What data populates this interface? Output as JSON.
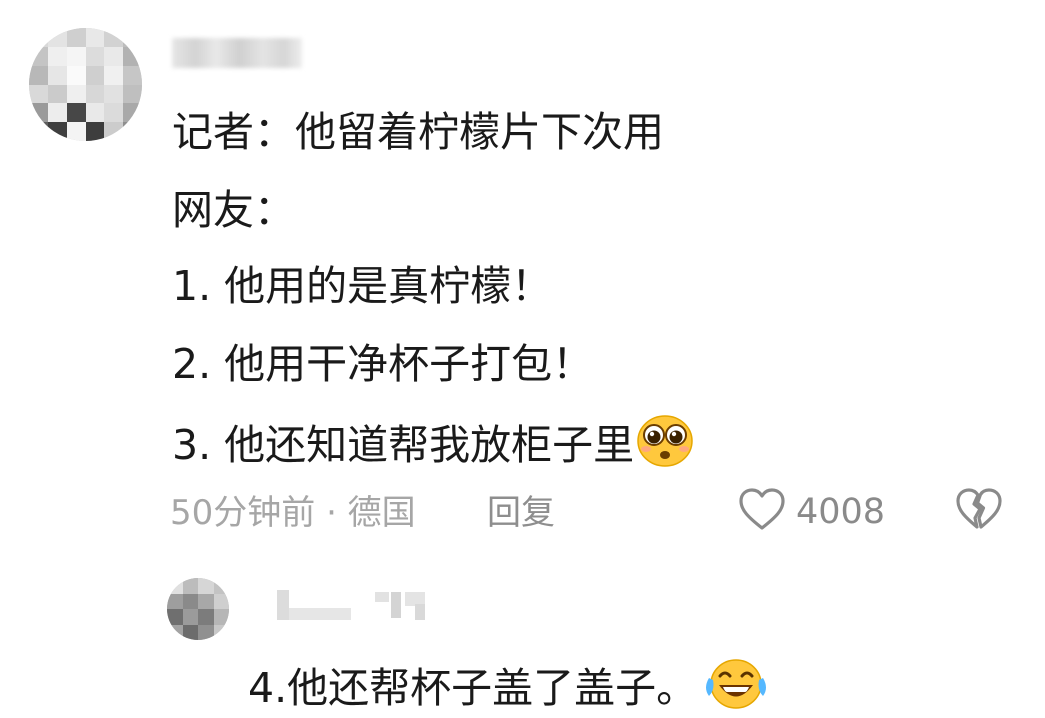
{
  "comment": {
    "lines": [
      "记者：他留着柠檬片下次用",
      "网友：",
      "1. 他用的是真柠檬！",
      "2. 他用干净杯子打包！",
      "3. 他还知道帮我放柜子里"
    ],
    "line3_emoji": "pleading-face-emoji",
    "meta": "50分钟前 · 德国",
    "reply_label": "回复",
    "like_count": "4008",
    "like_icon": "heart-outline-icon",
    "dislike_icon": "broken-heart-icon"
  },
  "reply": {
    "text": "4.他还帮杯子盖了盖子。",
    "emoji": "tears-of-joy-emoji"
  },
  "colors": {
    "text": "#1a1a1a",
    "meta": "#a6a6a6",
    "icon": "#8a8a8a",
    "emoji_yellow": "#ffc83d"
  }
}
